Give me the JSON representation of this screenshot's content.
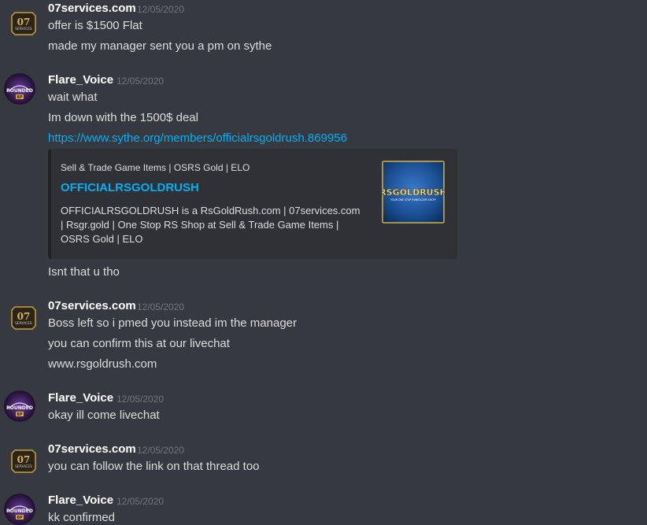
{
  "colors": {
    "background": "#36393f",
    "username": "#ffffff",
    "timestamp": "#72767d",
    "message_text": "#dcddde",
    "link": "#00b0f4",
    "embed_bg": "#2f3136"
  },
  "messages": [
    {
      "author": "07services.com",
      "avatar_icon": "07services-logo-icon",
      "timestamp": "12/05/2020",
      "lines": [
        "offer is $1500 Flat",
        "made my manager sent you a pm on sythe"
      ]
    },
    {
      "author": "Flare_Voice",
      "avatar_icon": "flare-voice-avatar-icon",
      "timestamp": "12/05/2020",
      "lines": [
        "wait what",
        "Im down with the 1500$ deal"
      ],
      "link": "https://www.sythe.org/members/officialrsgoldrush.869956",
      "embed": {
        "provider": "Sell & Trade Game Items | OSRS Gold | ELO",
        "title": "OFFICIALRSGOLDRUSH",
        "description": "OFFICIALRSGOLDRUSH is a RsGoldRush.com | 07services.com | Rsgr.gold | One Stop RS Shop at Sell & Trade Game Items | OSRS Gold | ELO",
        "thumbnail_text": "RSGOLDRUSH",
        "thumbnail_subtext": "YOUR ONE STOP RUNESCAPE SHOP!"
      },
      "after_embed": "Isnt that u tho"
    },
    {
      "author": "07services.com",
      "avatar_icon": "07services-logo-icon",
      "timestamp": "12/05/2020",
      "lines": [
        "Boss left so i pmed you instead im the manager",
        "you can confirm this at our livechat",
        "www.rsgoldrush.com"
      ]
    },
    {
      "author": "Flare_Voice",
      "avatar_icon": "flare-voice-avatar-icon",
      "timestamp": "12/05/2020",
      "lines": [
        "okay ill come livechat"
      ]
    },
    {
      "author": "07services.com",
      "avatar_icon": "07services-logo-icon",
      "timestamp": "12/05/2020",
      "lines": [
        "you can follow the link on that thread too"
      ]
    },
    {
      "author": "Flare_Voice",
      "avatar_icon": "flare-voice-avatar-icon",
      "timestamp": "12/05/2020",
      "lines": [
        "kk confirmed"
      ]
    }
  ],
  "logo_07": {
    "number": "07",
    "word": "SERVICES"
  },
  "flare_avatar": {
    "word": "ROUNDED",
    "badge": "BP"
  }
}
